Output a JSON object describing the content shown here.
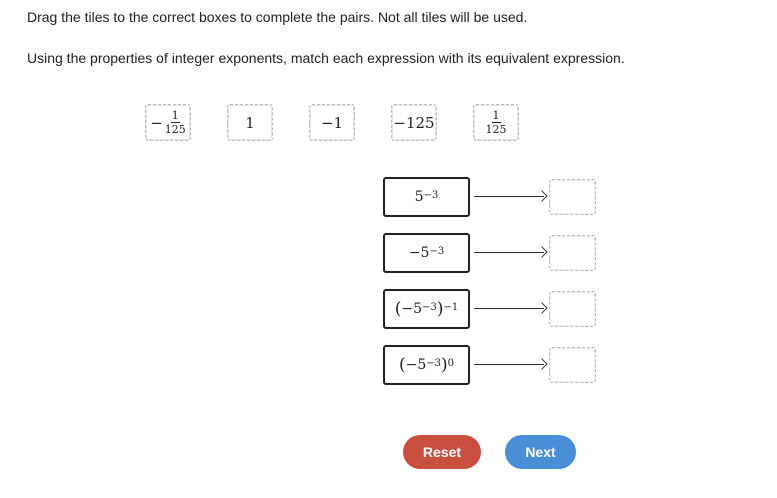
{
  "instructions": {
    "line1": "Drag the tiles to the correct boxes to complete the pairs. Not all tiles will be used.",
    "line2": "Using the properties of integer exponents, match each expression with its equivalent expression."
  },
  "tiles": {
    "t1": {
      "sign": "−",
      "num": "1",
      "den": "125"
    },
    "t2": {
      "text": "1"
    },
    "t3": {
      "text": "−1"
    },
    "t4": {
      "text": "−125"
    },
    "t5": {
      "num": "1",
      "den": "125"
    }
  },
  "expressions": {
    "e1": {
      "base": "5",
      "exp": "−3"
    },
    "e2": {
      "base": "−5",
      "exp": "−3"
    },
    "e3": {
      "open": "(",
      "base": "−5",
      "exp": "−3",
      "close": ")",
      "outer_exp": "−1"
    },
    "e4": {
      "open": "(",
      "base": "−5",
      "exp": "−3",
      "close": ")",
      "outer_exp": "0"
    }
  },
  "buttons": {
    "reset": "Reset",
    "next": "Next"
  },
  "colors": {
    "reset": "#c9503f",
    "next": "#4a8ed8"
  }
}
